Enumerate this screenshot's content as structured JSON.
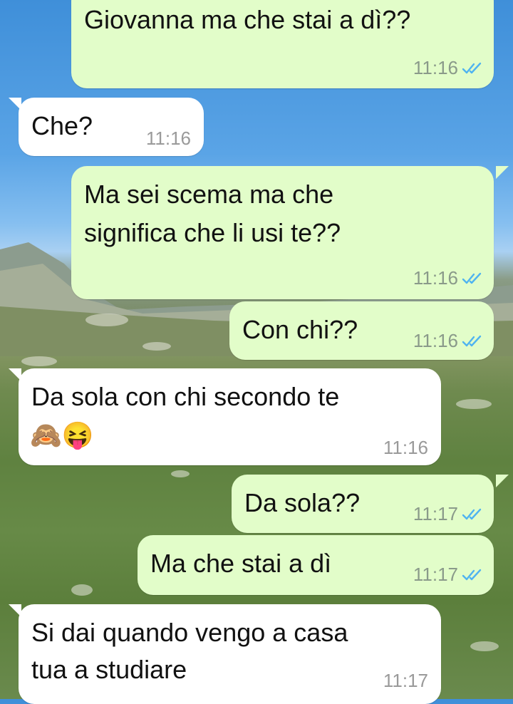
{
  "messages": [
    {
      "direction": "outgoing",
      "text": "Giovanna ma che stai a dì??",
      "time": "11:16",
      "status_icon": "double-check-read-icon"
    },
    {
      "direction": "incoming",
      "text": "Che?",
      "time": "11:16"
    },
    {
      "direction": "outgoing",
      "text_line1": "Ma sei scema ma che",
      "text_line2": "significa che li usi te??",
      "time": "11:16",
      "status_icon": "double-check-read-icon"
    },
    {
      "direction": "outgoing",
      "text": "Con chi??",
      "time": "11:16",
      "status_icon": "double-check-read-icon"
    },
    {
      "direction": "incoming",
      "text": "Da sola con chi secondo te",
      "emojis": "🙈😝",
      "time": "11:16"
    },
    {
      "direction": "outgoing",
      "text": "Da sola??",
      "time": "11:17",
      "status_icon": "double-check-read-icon"
    },
    {
      "direction": "outgoing",
      "text": "Ma che stai a dì",
      "time": "11:17",
      "status_icon": "double-check-read-icon"
    },
    {
      "direction": "incoming",
      "text_line1": "Si dai quando vengo a casa",
      "text_line2": "tua a studiare",
      "time": "11:17"
    }
  ],
  "colors": {
    "outgoing_bubble": "#e2fdc9",
    "incoming_bubble": "#ffffff",
    "read_tick": "#4fb3f0"
  }
}
